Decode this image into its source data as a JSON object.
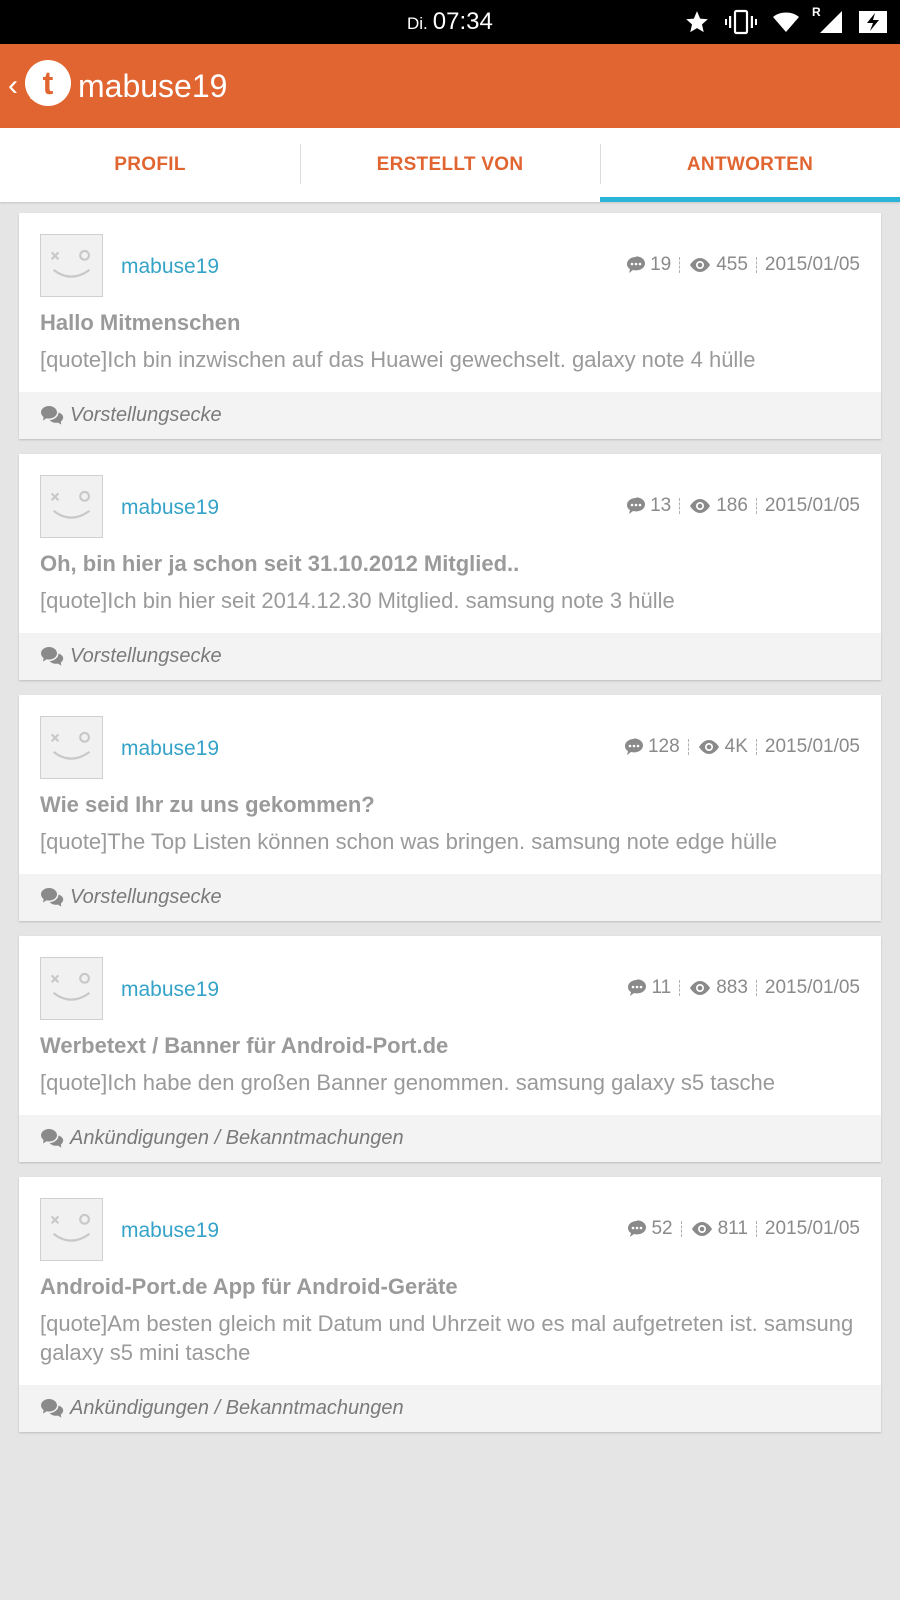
{
  "status_bar": {
    "day": "Di.",
    "time": "07:34",
    "roaming": "R"
  },
  "app_bar": {
    "title": "mabuse19"
  },
  "tabs": [
    {
      "label": "PROFIL",
      "active": false
    },
    {
      "label": "ERSTELLT VON",
      "active": false
    },
    {
      "label": "ANTWORTEN",
      "active": true
    }
  ],
  "colors": {
    "accent": "#e06530",
    "tab_indicator": "#2ab4d8",
    "username": "#35a3c8"
  },
  "posts": [
    {
      "username": "mabuse19",
      "replies": "19",
      "views": "455",
      "date": "2015/01/05",
      "title": "Hallo Mitmenschen",
      "excerpt": "[quote]Ich bin inzwischen auf das Huawei gewechselt. galaxy note 4 hülle",
      "forum": "Vorstellungsecke"
    },
    {
      "username": "mabuse19",
      "replies": "13",
      "views": "186",
      "date": "2015/01/05",
      "title": "Oh, bin hier ja schon seit 31.10.2012 Mitglied..",
      "excerpt": "[quote]Ich bin hier seit 2014.12.30 Mitglied. samsung note 3 hülle",
      "forum": "Vorstellungsecke"
    },
    {
      "username": "mabuse19",
      "replies": "128",
      "views": "4K",
      "date": "2015/01/05",
      "title": "Wie seid Ihr zu uns gekommen?",
      "excerpt": "[quote]The Top Listen können schon was bringen. samsung note edge hülle",
      "forum": "Vorstellungsecke"
    },
    {
      "username": "mabuse19",
      "replies": "11",
      "views": "883",
      "date": "2015/01/05",
      "title": "Werbetext / Banner für Android-Port.de",
      "excerpt": "[quote]Ich habe den großen Banner genommen. samsung galaxy s5 tasche",
      "forum": "Ankündigungen / Bekanntmachungen"
    },
    {
      "username": "mabuse19",
      "replies": "52",
      "views": "811",
      "date": "2015/01/05",
      "title": "Android-Port.de App für Android-Geräte",
      "excerpt": "[quote]Am besten gleich mit Datum und Uhrzeit wo es mal aufgetreten ist. samsung galaxy s5 mini tasche",
      "forum": "Ankündigungen / Bekanntmachungen"
    }
  ]
}
